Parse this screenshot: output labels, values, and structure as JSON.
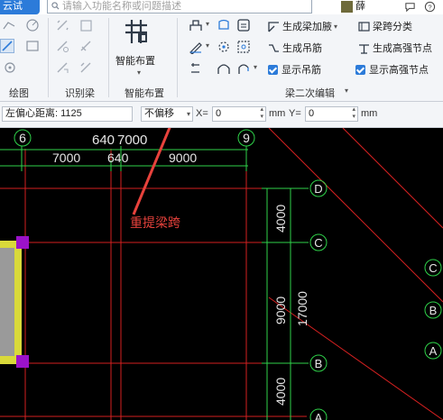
{
  "topbar": {
    "active_tab": "云试",
    "search_placeholder": "请输入功能名称或问题描述",
    "user_name": "薛子庆"
  },
  "ribbon": {
    "groups": {
      "draw": "绘图",
      "identify": "识别梁",
      "smart": "智能布置",
      "beam_secondary": "梁二次编辑"
    },
    "smart_layout_label": "智能布置",
    "buttons": {
      "gen_haunch": "生成梁加腋",
      "span_class": "梁跨分类",
      "gen_hanger": "生成吊筋",
      "gen_hs_node": "生成高强节点",
      "show_hanger": "显示吊筋",
      "show_hs_node": "显示高强节点"
    }
  },
  "props": {
    "left_offset_label": "左偏心距离: 1125",
    "mode_value": "不偏移",
    "x_label": "X=",
    "x_value": "0",
    "unit1": "mm",
    "y_label": "Y=",
    "y_value": "0",
    "unit2": "mm"
  },
  "canvas": {
    "axis_6": "6",
    "axis_9": "9",
    "dim_top": "640",
    "dim_top2": "7000",
    "dim_7000": "7000",
    "dim_640": "640",
    "dim_9000": "9000",
    "axis_D": "D",
    "axis_C": "C",
    "axis_B": "B",
    "axis_A": "A",
    "axis_C2": "C",
    "axis_B2": "B",
    "axis_A2": "A",
    "dim_v_4000a": "4000",
    "dim_v_9000": "9000",
    "dim_v_17000": "17000",
    "dim_v_4000b": "4000",
    "annotation": "重提梁跨"
  },
  "colors": {
    "accent": "#2c7bd9",
    "annotation": "#e8423c",
    "beam_red": "#d42020",
    "dim_green": "#2fd24a",
    "purple_grip": "#9b12c9"
  }
}
